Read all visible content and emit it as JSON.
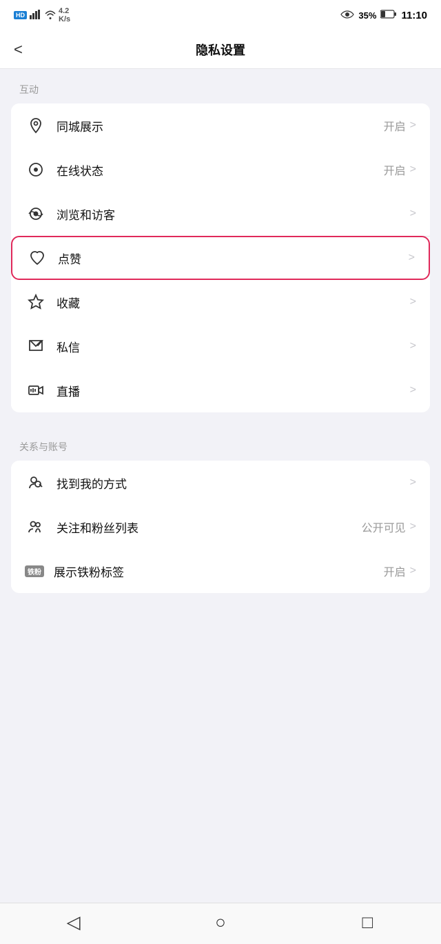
{
  "statusBar": {
    "hdBadge": "HD",
    "signal": "46",
    "wifi": "4.2\nK/s",
    "eye": "👁",
    "battery": "35%",
    "time": "11:10"
  },
  "header": {
    "backLabel": "<",
    "title": "隐私设置"
  },
  "sections": [
    {
      "label": "互动",
      "items": [
        {
          "icon": "location",
          "label": "同城展示",
          "value": "开启",
          "chevron": ">",
          "highlighted": false
        },
        {
          "icon": "online",
          "label": "在线状态",
          "value": "开启",
          "chevron": ">",
          "highlighted": false
        },
        {
          "icon": "eye",
          "label": "浏览和访客",
          "value": "",
          "chevron": ">",
          "highlighted": false
        },
        {
          "icon": "heart",
          "label": "点赞",
          "value": "",
          "chevron": ">",
          "highlighted": true
        },
        {
          "icon": "star",
          "label": "收藏",
          "value": "",
          "chevron": ">",
          "highlighted": false
        },
        {
          "icon": "message",
          "label": "私信",
          "value": "",
          "chevron": ">",
          "highlighted": false
        },
        {
          "icon": "live",
          "label": "直播",
          "value": "",
          "chevron": ">",
          "highlighted": false
        }
      ]
    },
    {
      "label": "关系与账号",
      "items": [
        {
          "icon": "find",
          "label": "找到我的方式",
          "value": "",
          "chevron": ">",
          "highlighted": false
        },
        {
          "icon": "follow",
          "label": "关注和粉丝列表",
          "value": "公开可见",
          "chevron": ">",
          "highlighted": false
        },
        {
          "icon": "ironbadge",
          "label": "展示铁粉标签",
          "value": "开启",
          "chevron": ">",
          "highlighted": false,
          "badgeText": "铁粉"
        }
      ]
    }
  ],
  "bottomNav": {
    "back": "◁",
    "home": "○",
    "recent": "□"
  }
}
